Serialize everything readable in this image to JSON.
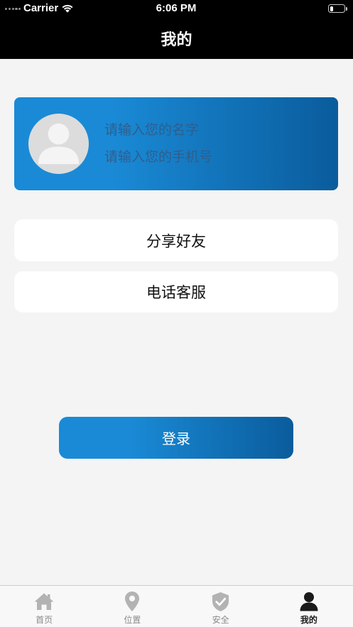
{
  "status_bar": {
    "carrier": "Carrier",
    "time": "6:06 PM",
    "battery_level": 0.25,
    "icons": [
      "signal-icon",
      "wifi-icon",
      "battery-icon"
    ]
  },
  "nav": {
    "title": "我的"
  },
  "profile": {
    "avatar_icon": "avatar-placeholder-icon",
    "name_placeholder": "请输入您的名字",
    "phone_placeholder": "请输入您的手机号"
  },
  "menu": {
    "items": [
      {
        "label": "分享好友"
      },
      {
        "label": "电话客服"
      }
    ]
  },
  "login": {
    "label": "登录"
  },
  "tabbar": {
    "tabs": [
      {
        "label": "首页",
        "icon": "home-icon",
        "active": false
      },
      {
        "label": "位置",
        "icon": "location-pin-icon",
        "active": false
      },
      {
        "label": "安全",
        "icon": "shield-check-icon",
        "active": false
      },
      {
        "label": "我的",
        "icon": "person-icon",
        "active": true
      }
    ]
  },
  "colors": {
    "accent_start": "#1a8ad6",
    "accent_end": "#0a5c9c",
    "header_bg": "#000000",
    "page_bg": "#f4f4f4",
    "placeholder_text": "#2f5e8d",
    "tab_inactive_icon": "#b3b3b3",
    "tab_inactive_label": "#8a8a8a",
    "tab_active": "#1a1a1a"
  }
}
